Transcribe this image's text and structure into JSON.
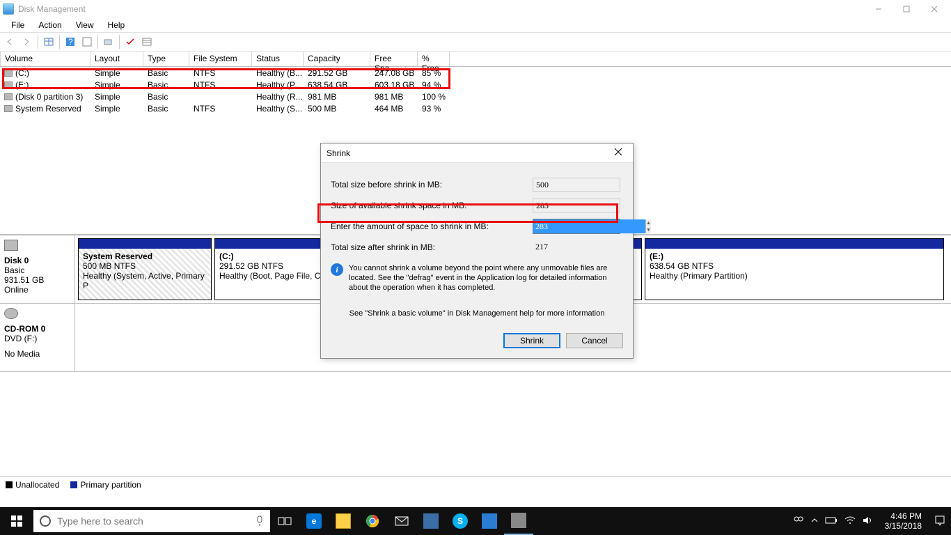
{
  "window": {
    "title": "Disk Management"
  },
  "menu": {
    "file": "File",
    "action": "Action",
    "view": "View",
    "help": "Help"
  },
  "volumes": {
    "headers": {
      "volume": "Volume",
      "layout": "Layout",
      "type": "Type",
      "fs": "File System",
      "status": "Status",
      "capacity": "Capacity",
      "free": "Free Spa...",
      "pct": "% Free"
    },
    "rows": [
      {
        "name": "(C:)",
        "layout": "Simple",
        "type": "Basic",
        "fs": "NTFS",
        "status": "Healthy (B...",
        "capacity": "291.52 GB",
        "free": "247.08 GB",
        "pct": "85 %"
      },
      {
        "name": "(E:)",
        "layout": "Simple",
        "type": "Basic",
        "fs": "NTFS",
        "status": "Healthy (P...",
        "capacity": "638.54 GB",
        "free": "603.18 GB",
        "pct": "94 %"
      },
      {
        "name": "(Disk 0 partition 3)",
        "layout": "Simple",
        "type": "Basic",
        "fs": "",
        "status": "Healthy (R...",
        "capacity": "981 MB",
        "free": "981 MB",
        "pct": "100 %"
      },
      {
        "name": "System Reserved",
        "layout": "Simple",
        "type": "Basic",
        "fs": "NTFS",
        "status": "Healthy (S...",
        "capacity": "500 MB",
        "free": "464 MB",
        "pct": "93 %"
      }
    ]
  },
  "disk0": {
    "label": "Disk 0",
    "type": "Basic",
    "size": "931.51 GB",
    "status": "Online",
    "parts": [
      {
        "name": "System Reserved",
        "size": "500 MB NTFS",
        "status": "Healthy (System, Active, Primary P"
      },
      {
        "name": "(C:)",
        "size": "291.52 GB NTFS",
        "status": "Healthy (Boot, Page File, Cr"
      },
      {
        "name": "(E:)",
        "size": "638.54 GB NTFS",
        "status": "Healthy (Primary Partition)"
      }
    ]
  },
  "cdrom": {
    "label": "CD-ROM 0",
    "drive": "DVD (F:)",
    "status": "No Media"
  },
  "legend": {
    "unalloc": "Unallocated",
    "primary": "Primary partition"
  },
  "dialog": {
    "title": "Shrink",
    "labels": {
      "total_before": "Total size before shrink in MB:",
      "avail": "Size of available shrink space in MB:",
      "enter": "Enter the amount of space to shrink in MB:",
      "total_after": "Total size after shrink in MB:"
    },
    "values": {
      "total_before": "500",
      "avail": "283",
      "enter": "283",
      "total_after": "217"
    },
    "info": "You cannot shrink a volume beyond the point where any unmovable files are located. See the \"defrag\" event in the Application log for detailed information about the operation when it has completed.",
    "help": "See \"Shrink a basic volume\" in Disk Management help for more information",
    "buttons": {
      "shrink": "Shrink",
      "cancel": "Cancel"
    }
  },
  "taskbar": {
    "search_placeholder": "Type here to search",
    "time": "4:46 PM",
    "date": "3/15/2018"
  }
}
